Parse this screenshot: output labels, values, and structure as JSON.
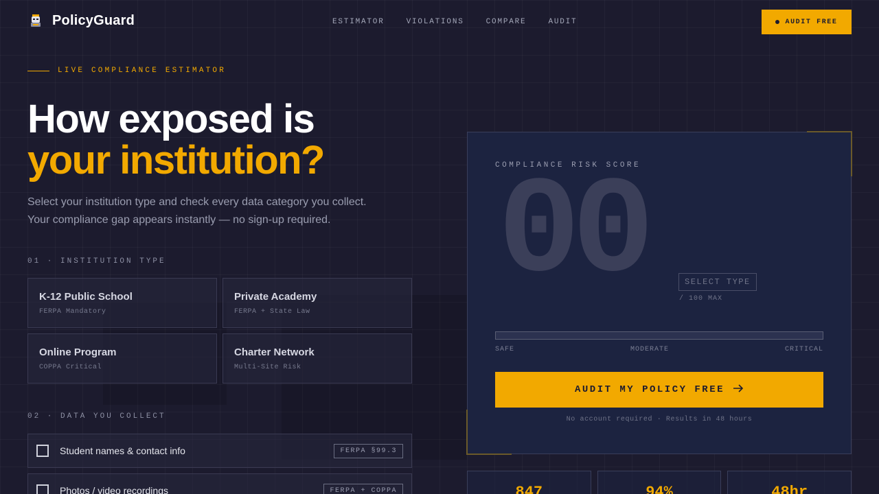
{
  "nav": {
    "brand": "PolicyGuard",
    "links": [
      "ESTIMATOR",
      "VIOLATIONS",
      "COMPARE",
      "AUDIT"
    ],
    "cta": "AUDIT FREE"
  },
  "hero": {
    "eyebrow": "LIVE COMPLIANCE ESTIMATOR",
    "headline_line1": "How exposed is",
    "headline_line2": "your institution?",
    "subtext_line1": "Select your institution type and check every data category you collect.",
    "subtext_line2": "Your compliance gap appears instantly — no sign-up required."
  },
  "section1": {
    "label": "01 · INSTITUTION TYPE",
    "types": [
      {
        "title": "K-12 Public School",
        "sub": "FERPA Mandatory"
      },
      {
        "title": "Private Academy",
        "sub": "FERPA + State Law"
      },
      {
        "title": "Online Program",
        "sub": "COPPA Critical"
      },
      {
        "title": "Charter Network",
        "sub": "Multi-Site Risk"
      }
    ]
  },
  "section2": {
    "label": "02 · DATA YOU COLLECT",
    "items": [
      {
        "label": "Student names & contact info",
        "tag": "FERPA §99.3"
      },
      {
        "label": "Photos / video recordings",
        "tag": "FERPA + COPPA"
      }
    ]
  },
  "score_panel": {
    "label": "COMPLIANCE RISK SCORE",
    "score": "00",
    "score_fraction": 0,
    "status": "SELECT TYPE",
    "max": "/ 100 MAX",
    "meter_labels": [
      "SAFE",
      "MODERATE",
      "CRITICAL"
    ],
    "button": "AUDIT MY POLICY FREE",
    "note": "No account required · Results in 48 hours"
  },
  "stats": [
    "847",
    "94%",
    "48hr"
  ],
  "colors": {
    "accent": "#f2a900",
    "background": "#1c1b2e",
    "panel": "#1c2340"
  }
}
